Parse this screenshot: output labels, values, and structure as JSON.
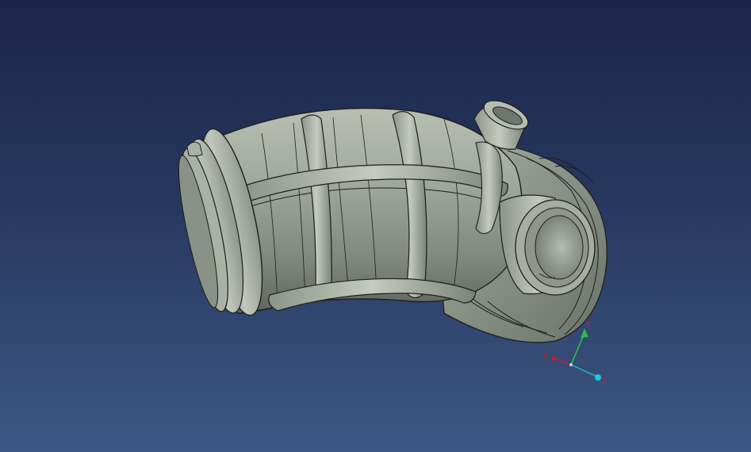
{
  "viewport": {
    "background_top": "#1b2548",
    "background_bottom": "#3c5784"
  },
  "model": {
    "name": "",
    "surface_color": "#9aa296",
    "edge_color": "#1c1f1c"
  },
  "triad": {
    "x_label": "X",
    "y_label": "Y",
    "z_label": "Z",
    "x_color": "#c0202a",
    "y_color": "#2fb84a",
    "z_color": "#22a8c8"
  }
}
